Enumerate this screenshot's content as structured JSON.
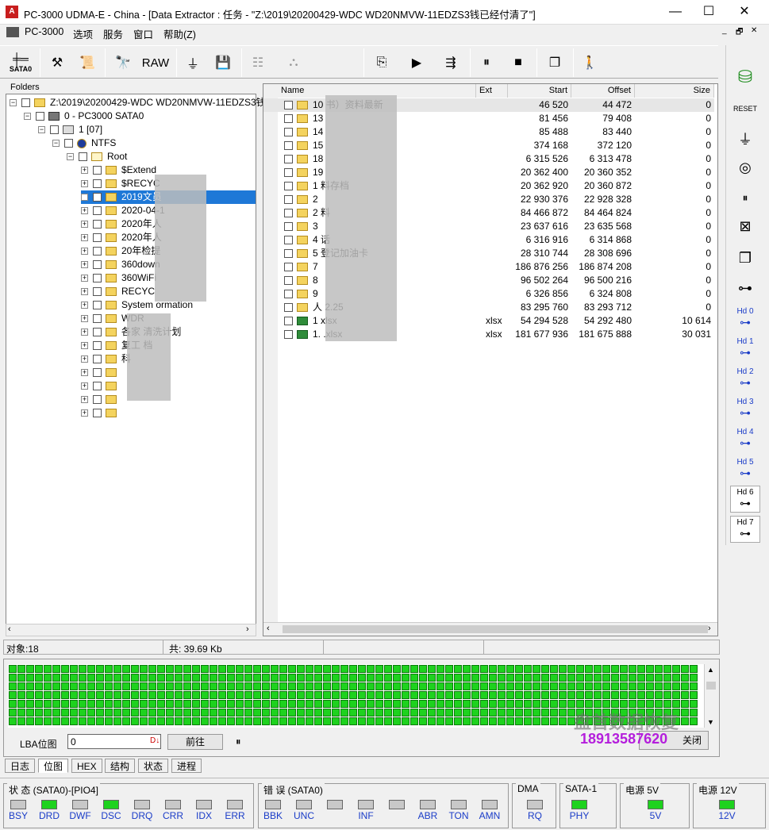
{
  "window": {
    "title": "PC-3000 UDMA-E - China - [Data Extractor : 任务 - \"Z:\\2019\\20200429-WDC WD20NMVW-11EDZS3钱已经付清了\"]",
    "minimize": "—",
    "maximize": "☐",
    "close": "✕"
  },
  "menu": {
    "items": [
      "PC-3000",
      "选项",
      "服务",
      "窗口",
      "帮助(Z)"
    ],
    "mdi": [
      "_",
      "🗗",
      "✕"
    ]
  },
  "toolbar": {
    "sata_label": "SATA0",
    "raw_label": "RAW"
  },
  "tree": {
    "header": "Folders",
    "rows": [
      {
        "label": "Z:\\2019\\20200429-WDC WD20NMVW-11EDZS3钱",
        "indent": 0
      },
      {
        "label": "0 - PC3000 SATA0",
        "indent": 1
      },
      {
        "label": "1 [07]",
        "indent": 2
      },
      {
        "label": "NTFS",
        "indent": 3
      },
      {
        "label": "Root",
        "indent": 4
      },
      {
        "label": "$Extend",
        "indent": 5
      },
      {
        "label": "$RECYC",
        "indent": 5
      },
      {
        "label": "2019文员",
        "indent": 5
      },
      {
        "label": "2020-04-1",
        "indent": 5
      },
      {
        "label": "2020年人",
        "indent": 5
      },
      {
        "label": "2020年人",
        "indent": 5
      },
      {
        "label": "20年检提",
        "indent": 5
      },
      {
        "label": "360down",
        "indent": 5
      },
      {
        "label": "360WiFi",
        "indent": 5
      },
      {
        "label": "RECYC",
        "indent": 5
      },
      {
        "label": "System              ormation",
        "indent": 5
      },
      {
        "label": "WDR",
        "indent": 5
      },
      {
        "label": "各家               清洗计划",
        "indent": 5
      },
      {
        "label": "复工               档",
        "indent": 5
      },
      {
        "label": "科",
        "indent": 5
      },
      {
        "label": "",
        "indent": 5
      },
      {
        "label": "",
        "indent": 5
      },
      {
        "label": "",
        "indent": 5
      },
      {
        "label": "",
        "indent": 5
      }
    ]
  },
  "files": {
    "columns": [
      "Name",
      "Ext",
      "Start",
      "Offset",
      "Size"
    ],
    "rows": [
      {
        "name": "10                书）资料最新",
        "ext": "",
        "start": "46 520",
        "offset": "44 472",
        "size": "0"
      },
      {
        "name": "13",
        "ext": "",
        "start": "81 456",
        "offset": "79 408",
        "size": "0"
      },
      {
        "name": "14",
        "ext": "",
        "start": "85 488",
        "offset": "83 440",
        "size": "0"
      },
      {
        "name": "15",
        "ext": "",
        "start": "374 168",
        "offset": "372 120",
        "size": "0"
      },
      {
        "name": "18",
        "ext": "",
        "start": "6 315 526",
        "offset": "6 313 478",
        "size": "0"
      },
      {
        "name": "19",
        "ext": "",
        "start": "20 362 400",
        "offset": "20 360 352",
        "size": "0"
      },
      {
        "name": "1                  料存档",
        "ext": "",
        "start": "20 362 920",
        "offset": "20 360 872",
        "size": "0"
      },
      {
        "name": "2",
        "ext": "",
        "start": "22 930 376",
        "offset": "22 928 328",
        "size": "0"
      },
      {
        "name": "2                  料",
        "ext": "",
        "start": "84 466 872",
        "offset": "84 464 824",
        "size": "0"
      },
      {
        "name": "3",
        "ext": "",
        "start": "23 637 616",
        "offset": "23 635 568",
        "size": "0"
      },
      {
        "name": "4               话",
        "ext": "",
        "start": "6 316 916",
        "offset": "6 314 868",
        "size": "0"
      },
      {
        "name": "5                登记加油卡",
        "ext": "",
        "start": "28 310 744",
        "offset": "28 308 696",
        "size": "0"
      },
      {
        "name": "7",
        "ext": "",
        "start": "186 876 256",
        "offset": "186 874 208",
        "size": "0"
      },
      {
        "name": "8",
        "ext": "",
        "start": "96 502 264",
        "offset": "96 500 216",
        "size": "0"
      },
      {
        "name": "9",
        "ext": "",
        "start": "6 326 856",
        "offset": "6 324 808",
        "size": "0"
      },
      {
        "name": "人           2.25",
        "ext": "",
        "start": "83 295 760",
        "offset": "83 293 712",
        "size": "0"
      },
      {
        "name": "1              xlsx",
        "ext": "xlsx",
        "start": "54 294 528",
        "offset": "54 292 480",
        "size": "10 614"
      },
      {
        "name": "1.                .xlsx",
        "ext": "xlsx",
        "start": "181 677 936",
        "offset": "181 675 888",
        "size": "30 031"
      }
    ]
  },
  "status": {
    "objects": "对象:18",
    "total": "共: 39.69 Kb"
  },
  "bitmap": {
    "lba_label": "LBA位图",
    "lba_value": "0",
    "forward": "前往",
    "pause": "⏸",
    "watermark1": "盘首数据恢复",
    "watermark2": "18913587620",
    "button_partial": "关闭"
  },
  "tabs": [
    "日志",
    "位图",
    "HEX",
    "结构",
    "状态",
    "进程"
  ],
  "indicators": {
    "state": {
      "title": "状 态 (SATA0)-[PIO4]",
      "leds": [
        {
          "l": "BSY",
          "on": false
        },
        {
          "l": "DRD",
          "on": true
        },
        {
          "l": "DWF",
          "on": false
        },
        {
          "l": "DSC",
          "on": true
        },
        {
          "l": "DRQ",
          "on": false
        },
        {
          "l": "CRR",
          "on": false
        },
        {
          "l": "IDX",
          "on": false
        },
        {
          "l": "ERR",
          "on": false
        }
      ]
    },
    "error": {
      "title": "错 误 (SATA0)",
      "leds": [
        {
          "l": "BBK",
          "on": false
        },
        {
          "l": "UNC",
          "on": false
        },
        {
          "l": "",
          "on": false
        },
        {
          "l": "INF",
          "on": false
        },
        {
          "l": "",
          "on": false
        },
        {
          "l": "ABR",
          "on": false
        },
        {
          "l": "TON",
          "on": false
        },
        {
          "l": "AMN",
          "on": false
        }
      ]
    },
    "dma": {
      "title": "DMA",
      "led": "RQ"
    },
    "sata": {
      "title": "SATA-1",
      "led": "PHY"
    },
    "p5": {
      "title": "电源 5V",
      "led": "5V"
    },
    "p12": {
      "title": "电源 12V",
      "led": "12V"
    }
  },
  "right_toolbar": [
    "Hd 0",
    "Hd 1",
    "Hd 2",
    "Hd 3",
    "Hd 4",
    "Hd 5",
    "Hd 6",
    "Hd 7"
  ],
  "colors": {
    "led_on": "#1ed21e",
    "led_off": "#c8c8c8",
    "selection": "#1e78d7"
  }
}
